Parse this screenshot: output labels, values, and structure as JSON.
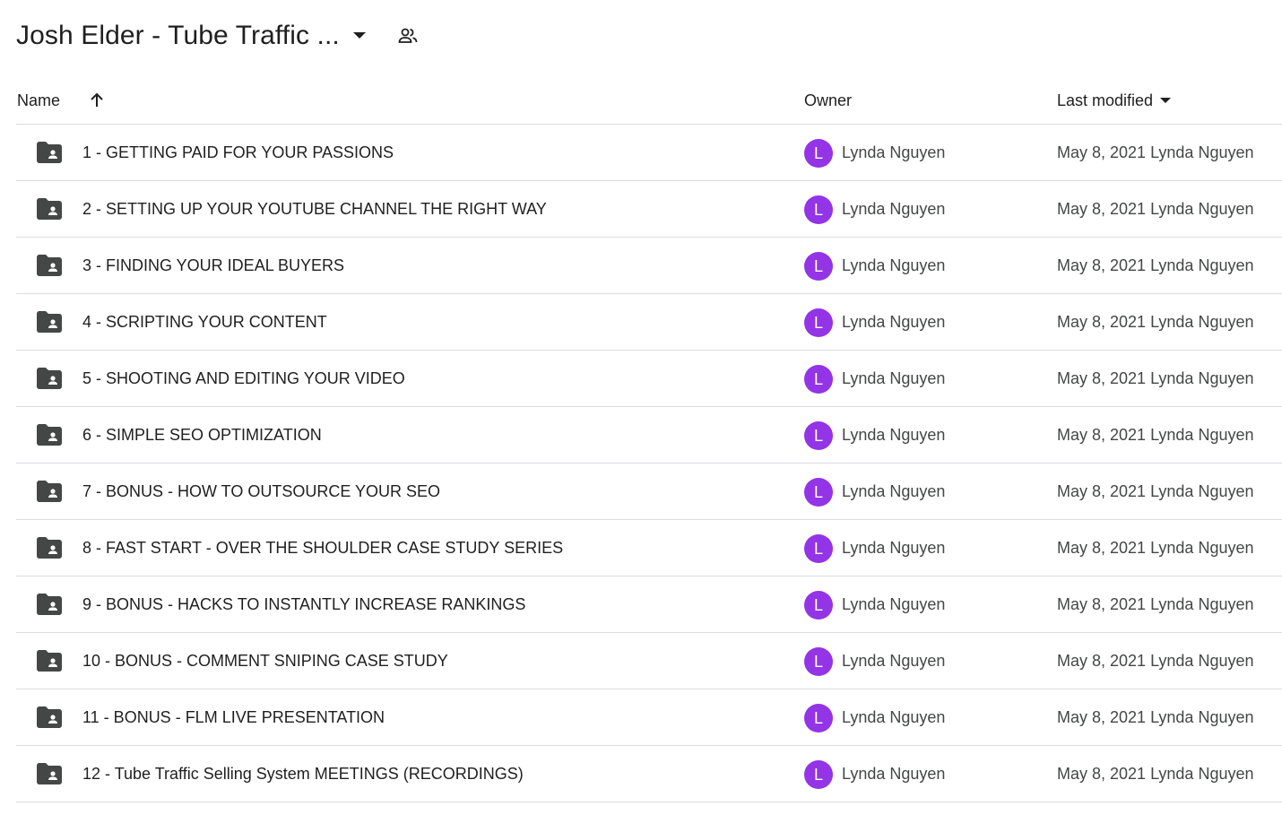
{
  "header": {
    "title": "Josh Elder - Tube Traffic ...",
    "dropdown_icon": "arrow-drop-down-icon",
    "people_icon": "shared-people-icon"
  },
  "columns": {
    "name": "Name",
    "sort_icon": "arrow-upward-icon",
    "owner": "Owner",
    "last_modified": "Last modified"
  },
  "colors": {
    "avatar_bg": "#9334e6",
    "folder_icon": "#444746",
    "divider": "#dadce0"
  },
  "rows": [
    {
      "name": "1 - GETTING PAID FOR YOUR PASSIONS",
      "owner_initial": "L",
      "owner": "Lynda Nguyen",
      "modified": "May 8, 2021 Lynda Nguyen"
    },
    {
      "name": "2 - SETTING UP YOUR YOUTUBE CHANNEL THE RIGHT WAY",
      "owner_initial": "L",
      "owner": "Lynda Nguyen",
      "modified": "May 8, 2021 Lynda Nguyen"
    },
    {
      "name": "3 - FINDING YOUR IDEAL BUYERS",
      "owner_initial": "L",
      "owner": "Lynda Nguyen",
      "modified": "May 8, 2021 Lynda Nguyen"
    },
    {
      "name": "4 - SCRIPTING YOUR CONTENT",
      "owner_initial": "L",
      "owner": "Lynda Nguyen",
      "modified": "May 8, 2021 Lynda Nguyen"
    },
    {
      "name": "5 - SHOOTING AND EDITING YOUR VIDEO",
      "owner_initial": "L",
      "owner": "Lynda Nguyen",
      "modified": "May 8, 2021 Lynda Nguyen"
    },
    {
      "name": "6 - SIMPLE SEO OPTIMIZATION",
      "owner_initial": "L",
      "owner": "Lynda Nguyen",
      "modified": "May 8, 2021 Lynda Nguyen"
    },
    {
      "name": "7 - BONUS - HOW TO OUTSOURCE YOUR SEO",
      "owner_initial": "L",
      "owner": "Lynda Nguyen",
      "modified": "May 8, 2021 Lynda Nguyen"
    },
    {
      "name": "8 - FAST START - OVER THE SHOULDER CASE STUDY SERIES",
      "owner_initial": "L",
      "owner": "Lynda Nguyen",
      "modified": "May 8, 2021 Lynda Nguyen"
    },
    {
      "name": "9 - BONUS - HACKS TO INSTANTLY INCREASE RANKINGS",
      "owner_initial": "L",
      "owner": "Lynda Nguyen",
      "modified": "May 8, 2021 Lynda Nguyen"
    },
    {
      "name": "10 - BONUS - COMMENT SNIPING CASE STUDY",
      "owner_initial": "L",
      "owner": "Lynda Nguyen",
      "modified": "May 8, 2021 Lynda Nguyen"
    },
    {
      "name": "11 - BONUS - FLM LIVE PRESENTATION",
      "owner_initial": "L",
      "owner": "Lynda Nguyen",
      "modified": "May 8, 2021 Lynda Nguyen"
    },
    {
      "name": "12 - Tube Traffic Selling System MEETINGS (RECORDINGS)",
      "owner_initial": "L",
      "owner": "Lynda Nguyen",
      "modified": "May 8, 2021 Lynda Nguyen"
    }
  ]
}
